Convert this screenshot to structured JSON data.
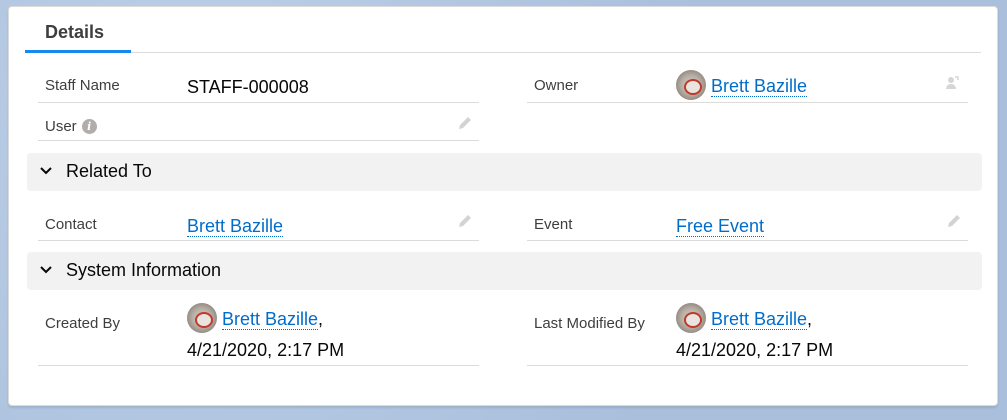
{
  "tabs": {
    "details": "Details"
  },
  "fields": {
    "staff_name": {
      "label": "Staff Name",
      "value": "STAFF-000008"
    },
    "owner": {
      "label": "Owner",
      "value": "Brett Bazille"
    },
    "user": {
      "label": "User",
      "info_glyph": "i"
    }
  },
  "sections": {
    "related_to": {
      "title": "Related To",
      "contact": {
        "label": "Contact",
        "value": "Brett Bazille"
      },
      "event": {
        "label": "Event",
        "value": "Free Event"
      }
    },
    "system_information": {
      "title": "System Information",
      "created_by": {
        "label": "Created By",
        "name": "Brett Bazille",
        "date": "4/21/2020, 2:17 PM"
      },
      "last_modified_by": {
        "label": "Last Modified By",
        "name": "Brett Bazille",
        "date": "4/21/2020, 2:17 PM"
      }
    }
  },
  "separator": ",",
  "icons": {
    "edit": "pencil-icon",
    "change_owner": "change-owner-icon",
    "info": "info-icon",
    "chevron": "chevron-down-icon",
    "avatar": "user-avatar"
  },
  "colors": {
    "link": "#006dcc",
    "tab_accent": "#1589ee",
    "section_bg": "#f3f2f2"
  }
}
